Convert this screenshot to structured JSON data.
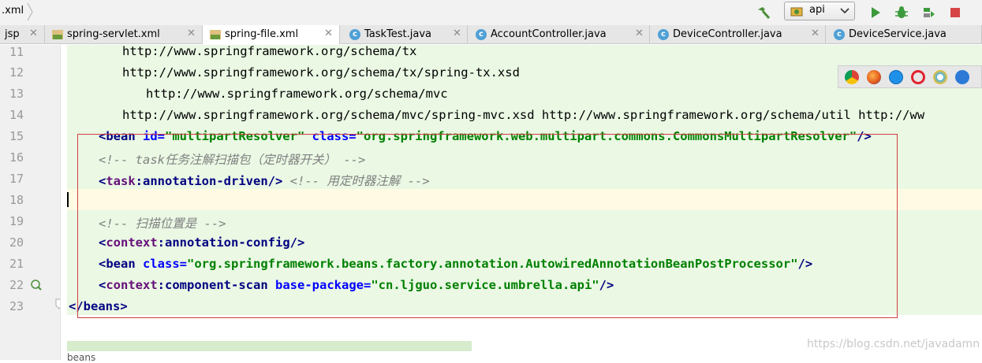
{
  "toolbar": {
    "breadcrumb": ".xml",
    "run_config": "api",
    "icons": [
      "hammer-icon",
      "run-config-icon",
      "dropdown-chevron-icon",
      "run-icon",
      "debug-icon",
      "coverage-icon",
      "stop-icon"
    ]
  },
  "tabs": [
    {
      "label": "jsp",
      "type": "partial"
    },
    {
      "label": "spring-servlet.xml",
      "type": "xml"
    },
    {
      "label": "spring-file.xml",
      "type": "xml",
      "active": true
    },
    {
      "label": "TaskTest.java",
      "type": "class"
    },
    {
      "label": "AccountController.java",
      "type": "class"
    },
    {
      "label": "DeviceController.java",
      "type": "class"
    },
    {
      "label": "DeviceService.java",
      "type": "class"
    }
  ],
  "line_numbers": [
    "11",
    "12",
    "13",
    "14",
    "15",
    "16",
    "17",
    "18",
    "19",
    "20",
    "21",
    "22",
    "23"
  ],
  "code": {
    "l11": "http://www.springframework.org/schema/tx",
    "l12": "http://www.springframework.org/schema/tx/spring-tx.xsd",
    "l13": "http://www.springframework.org/schema/mvc",
    "l14": "http://www.springframework.org/schema/mvc/spring-mvc.xsd http://www.springframework.org/schema/util http://ww",
    "l15": {
      "open": "<",
      "tag": "bean",
      "a1": " id=",
      "v1": "\"multipartResolver\"",
      "a2": " class=",
      "v2": "\"org.springframework.web.multipart.commons.CommonsMultipartResolver\"",
      "close": "/>"
    },
    "l16": "<!-- task任务注解扫描包（定时器开关） -->",
    "l17": {
      "open": "<",
      "ns": "task",
      "colon": ":",
      "tag": "annotation-driven",
      "close": "/>",
      "comment": " <!-- 用定时器注解 -->"
    },
    "l19": "<!-- 扫描位置是 -->",
    "l20": {
      "open": "<",
      "ns": "context",
      "colon": ":",
      "tag": "annotation-config",
      "close": "/>"
    },
    "l21": {
      "open": "<",
      "tag": "bean",
      "a1": " class=",
      "v1": "\"org.springframework.beans.factory.annotation.AutowiredAnnotationBeanPostProcessor\"",
      "close": "/>"
    },
    "l22": {
      "open": "<",
      "ns": "context",
      "colon": ":",
      "tag": "component-scan",
      "a1": " base-package=",
      "v1": "\"cn.ljguo.service.umbrella.api\"",
      "close": "/>"
    },
    "l23": {
      "open": "</",
      "tag": "beans",
      "close": ">"
    }
  },
  "browsers": [
    "chrome-icon",
    "firefox-icon",
    "safari-icon",
    "opera-icon",
    "ie-icon",
    "edge-icon"
  ],
  "status_breadcrumb": "beans",
  "watermark": "https://blog.csdn.net/javadamn",
  "colors": {
    "tag": "#000080",
    "attr": "#0000ff",
    "value": "#008000",
    "comment": "#808080",
    "namespace": "#660e7a",
    "changed_bg": "#eaf8e4",
    "current_line": "#fffae3",
    "highlight_box": "#d24040"
  }
}
